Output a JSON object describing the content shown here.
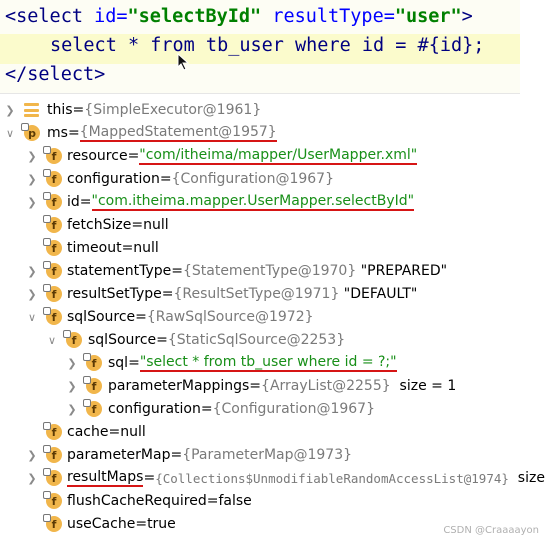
{
  "code": {
    "line1": {
      "open": "<select ",
      "id_attr": "id=",
      "id_val": "\"selectById\"",
      "rt_attr": " resultType=",
      "rt_val": "\"user\"",
      "close": ">"
    },
    "line2": "select * from tb_user where id = #{id};",
    "line3": "</select>"
  },
  "tree": {
    "this": {
      "name": "this",
      "eq": " = ",
      "val": "{SimpleExecutor@1961}"
    },
    "ms": {
      "name": "ms",
      "eq": " = ",
      "val": "{MappedStatement@1957}"
    },
    "resource": {
      "name": "resource",
      "eq": " = ",
      "val": "\"com/itheima/mapper/UserMapper.xml\""
    },
    "configuration": {
      "name": "configuration",
      "eq": " = ",
      "val": "{Configuration@1967}"
    },
    "id": {
      "name": "id",
      "eq": " = ",
      "val": "\"com.itheima.mapper.UserMapper.selectById\""
    },
    "fetchSize": {
      "name": "fetchSize",
      "eq": " = ",
      "val": "null"
    },
    "timeout": {
      "name": "timeout",
      "eq": " = ",
      "val": "null"
    },
    "statementType": {
      "name": "statementType",
      "eq": " = ",
      "val": "{StatementType@1970}",
      "extra": " \"PREPARED\""
    },
    "resultSetType": {
      "name": "resultSetType",
      "eq": " = ",
      "val": "{ResultSetType@1971}",
      "extra": " \"DEFAULT\""
    },
    "sqlSource": {
      "name": "sqlSource",
      "eq": " = ",
      "val": "{RawSqlSource@1972}"
    },
    "sqlSource2": {
      "name": "sqlSource",
      "eq": " = ",
      "val": "{StaticSqlSource@2253}"
    },
    "sql": {
      "name": "sql",
      "eq": " = ",
      "val": "\"select * from tb_user where id = ?;\""
    },
    "parameterMappings": {
      "name": "parameterMappings",
      "eq": " = ",
      "val": "{ArrayList@2255}",
      "extra": "  size = 1"
    },
    "configuration2": {
      "name": "configuration",
      "eq": " = ",
      "val": "{Configuration@1967}"
    },
    "cache": {
      "name": "cache",
      "eq": " = ",
      "val": "null"
    },
    "parameterMap": {
      "name": "parameterMap",
      "eq": " = ",
      "val": "{ParameterMap@1973}"
    },
    "resultMaps": {
      "name": "resultMaps",
      "eq": " = ",
      "val": "{Collections$UnmodifiableRandomAccessList@1974}",
      "extra": "  size"
    },
    "flushCacheRequired": {
      "name": "flushCacheRequired",
      "eq": " = ",
      "val": "false"
    },
    "useCache": {
      "name": "useCache",
      "eq": " = ",
      "val": "true"
    }
  },
  "badges": {
    "p": "p",
    "f": "f"
  },
  "watermark": "CSDN @Craaaayon",
  "colors": {
    "underline": "#d61515",
    "string": "#188f18",
    "ref": "#7a7a7a",
    "badge": "#f1b64b"
  }
}
